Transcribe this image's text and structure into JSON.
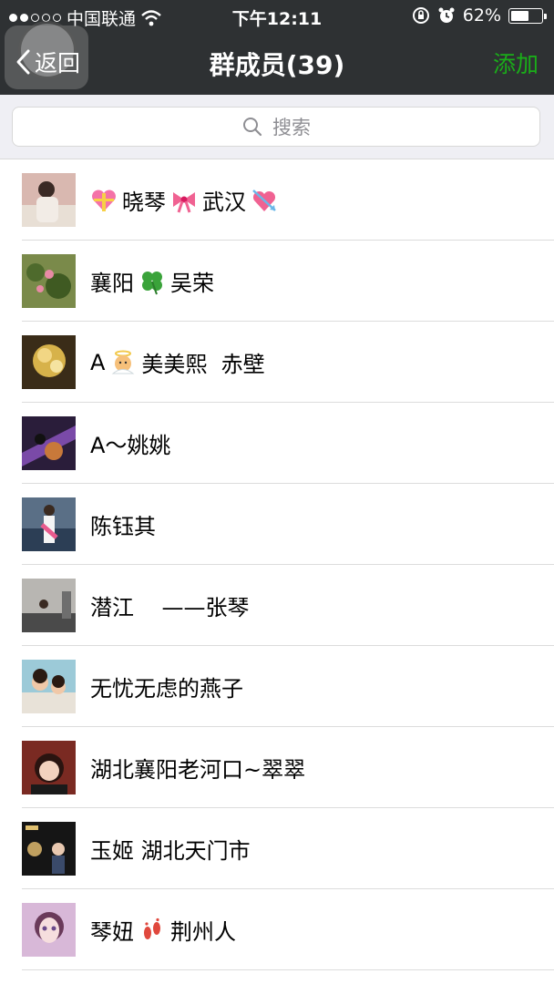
{
  "status_bar": {
    "carrier": "中国联通",
    "time": "下午12:11",
    "battery_text": "62%",
    "battery_level": 0.62,
    "signal_icon": "signal-dots",
    "wifi_icon": "wifi-icon",
    "lock_icon": "rotation-lock-icon",
    "alarm_icon": "alarm-icon"
  },
  "nav": {
    "back_label": "返回",
    "title": "群成员(39)",
    "add_label": "添加"
  },
  "search": {
    "placeholder": "搜索"
  },
  "members": [
    {
      "name_before": "",
      "name_parts": [
        "晓琴",
        "武汉"
      ],
      "emojis": [
        "gift-heart",
        "ribbon",
        "arrow-heart"
      ]
    },
    {
      "name_parts": [
        "襄阳",
        "吴荣"
      ],
      "emojis": [
        "four-leaf-clover"
      ]
    },
    {
      "name_parts": [
        "A",
        "美美熙  赤壁"
      ],
      "emojis": [
        "angel"
      ]
    },
    {
      "name": "A～姚姚"
    },
    {
      "name": "陈钰其"
    },
    {
      "name": "潜江    ——张琴"
    },
    {
      "name": "无忧无虑的燕子"
    },
    {
      "name": "湖北襄阳老河口~翠翠"
    },
    {
      "name": "玉姬 湖北天门市"
    },
    {
      "name_parts": [
        "琴妞",
        "荆州人"
      ],
      "emojis": [
        "footprints"
      ]
    }
  ],
  "colors": {
    "nav_bg": "#2e3133",
    "accent_green": "#1aad19",
    "search_bg": "#efeff4"
  }
}
